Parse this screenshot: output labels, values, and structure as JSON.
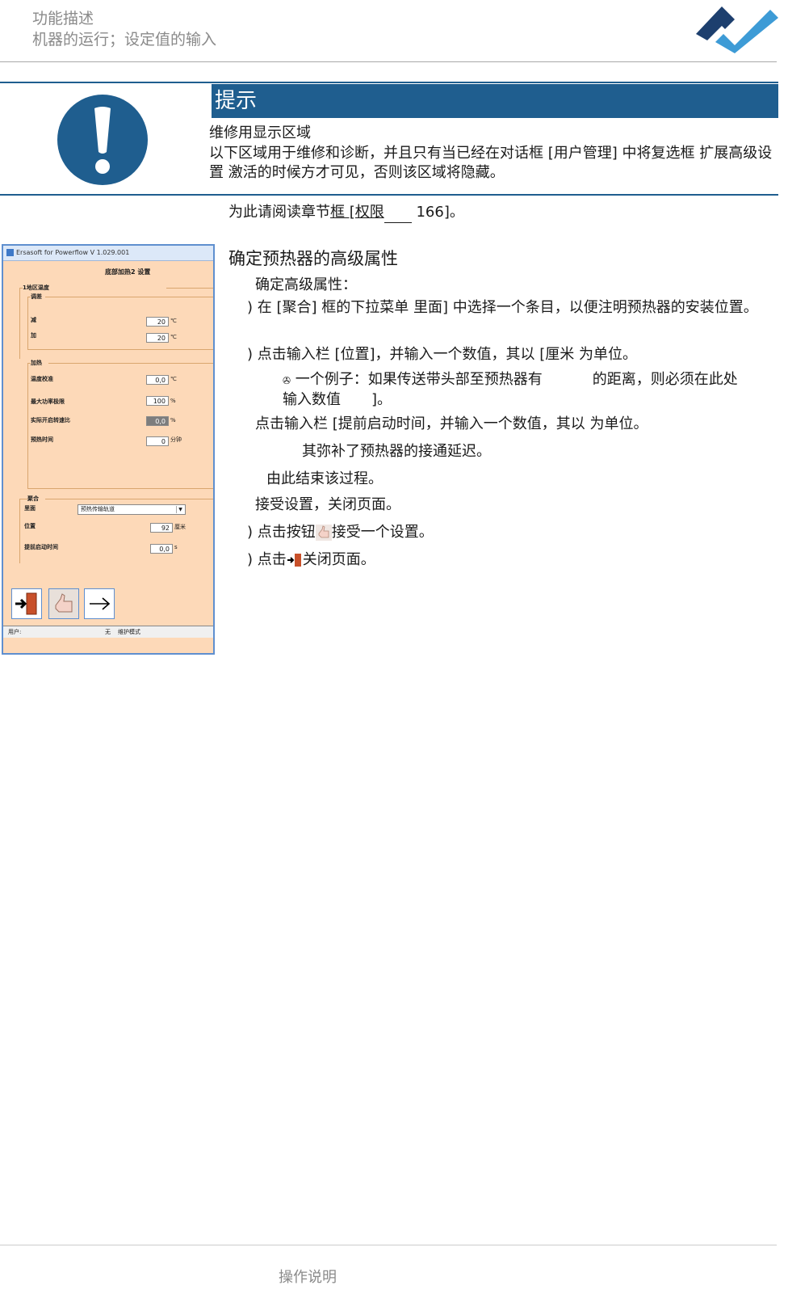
{
  "header": {
    "title": "功能描述",
    "subtitle": "机器的运行；设定值的输入"
  },
  "note": {
    "label": "提示",
    "line1": "维修用显示区域",
    "line2": "以下区域用于维修和诊断，并且只有当已经在对话框 [用户管理] 中将复选框  扩展高级设置  激活的时候方才可见，否则该区域将隐藏。"
  },
  "reference": {
    "prefix": "为此请阅读章节",
    "link": "框 [权限",
    "suffix": "166]。"
  },
  "section": {
    "title": "确定预热器的高级属性",
    "intro": "确定高级属性：",
    "step1": ") 在 [聚合] 框的下拉菜单  里面] 中选择一个条目，以便注明预热器的安装位置。",
    "step2": ") 点击输入栏 [位置]，并输入一个数值，其以 [厘米  为单位。",
    "example_a": "一个例子：如果传送带头部至预热器有",
    "example_b": "的距离，则必须在此处",
    "example_c": "输入数值",
    "example_d": "]。",
    "step3": "点击输入栏 [提前启动时间，并输入一个数值，其以     为单位。",
    "step3_note": "其弥补了预热器的接通延迟。",
    "end": "由此结束该过程。",
    "accept_title": "接受设置，关闭页面。",
    "accept1_a": ") 点击按钮",
    "accept1_b": "接受一个设置。",
    "accept2_a": ") 点击",
    "accept2_b": "关闭页面。"
  },
  "window": {
    "title": "Ersasoft for Powerflow V 1.029.001",
    "heading": "底部加热2  设置",
    "group1": "1地区温度",
    "group1_sub": "调差",
    "row_minus": "减",
    "row_plus": "加",
    "val_minus": "20",
    "val_plus": "20",
    "unit_c": "℃",
    "group2": "加热",
    "temp_cal": "温度校准",
    "temp_cal_val": "0,0",
    "max_power": "最大功率极限",
    "max_power_val": "100",
    "unit_pct": "%",
    "actual_duty": "实际开启转速比",
    "actual_duty_val": "0,0",
    "preheat_time": "预热时间",
    "preheat_time_val": "0",
    "unit_min": "分钟",
    "group3": "聚合",
    "inside": "里面",
    "inside_val": "预热传输轨道",
    "position": "位置",
    "position_val": "92",
    "unit_cm": "厘米",
    "lead_time": "提前启动时间",
    "lead_time_val": "0,0",
    "unit_s": "s",
    "status_user": "用户:",
    "status_none": "无",
    "status_mode": "维护模式"
  },
  "footer": {
    "text": "操作说明"
  },
  "colors": {
    "brand_blue": "#1f5e8f",
    "note_bar": "#1f5e8f",
    "window_bg": "#fdd9b8"
  }
}
